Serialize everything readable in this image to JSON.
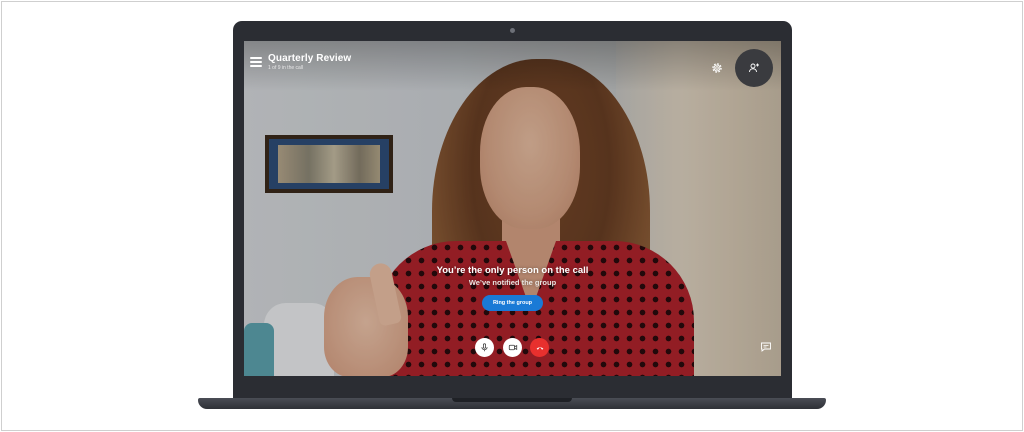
{
  "call": {
    "title": "Quarterly Review",
    "subtitle": "1 of 9 in the call",
    "status_title": "You’re the only person on the call",
    "status_subtitle": "We’ve notified the group",
    "ring_button_label": "Ring the group"
  },
  "icons": {
    "menu": "hamburger-menu-icon",
    "settings": "gear-icon",
    "add_people": "add-person-icon",
    "mic": "microphone-icon",
    "video": "video-camera-icon",
    "end_call": "hang-up-icon",
    "chat": "chat-icon"
  },
  "colors": {
    "ring_button": "#1a7ad6",
    "end_call": "#e8302e",
    "laptop_body": "#2b2d33"
  }
}
